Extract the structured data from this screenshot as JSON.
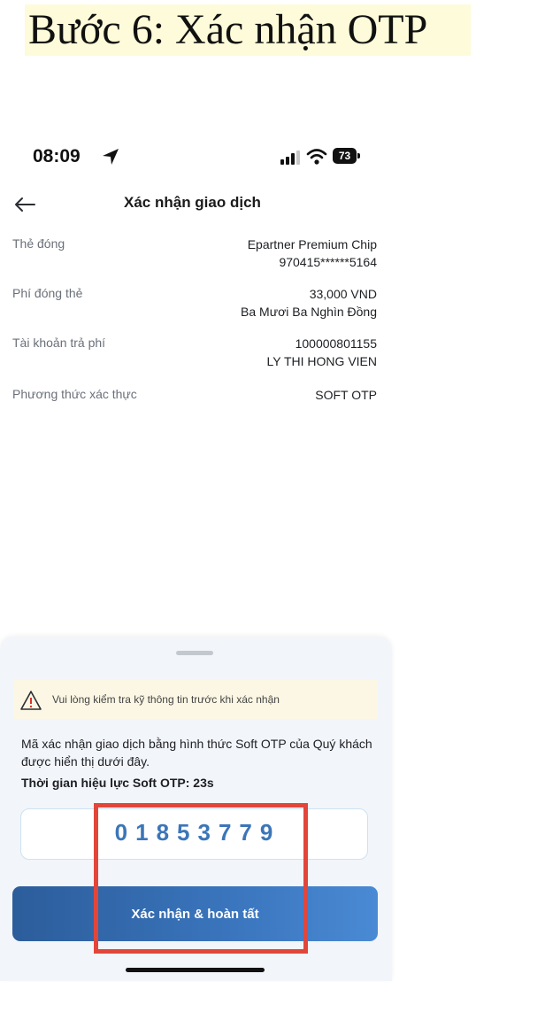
{
  "step_title": "Bước 6: Xác nhận OTP",
  "status_bar": {
    "time": "08:09",
    "battery": "73"
  },
  "header": {
    "title": "Xác nhận giao dịch"
  },
  "details": [
    {
      "label": "Thẻ đóng",
      "value_lines": [
        "Epartner Premium Chip",
        "970415******5164"
      ]
    },
    {
      "label": "Phí đóng thẻ",
      "value_lines": [
        "33,000 VND",
        "Ba Mươi Ba Nghìn Đồng"
      ]
    },
    {
      "label": "Tài khoản trả phí",
      "value_lines": [
        "100000801155",
        "LY THI HONG VIEN"
      ]
    },
    {
      "label": "Phương thức xác thực",
      "value_lines": [
        "SOFT OTP"
      ]
    }
  ],
  "sheet": {
    "warning": "Vui lòng kiểm tra kỹ thông tin trước khi xác nhận",
    "description": "Mã xác nhận giao dịch bằng hình thức Soft OTP của Quý khách được hiển thị dưới đây.",
    "timer": "Thời gian hiệu lực Soft OTP:  23s",
    "otp_code": "01853779",
    "confirm_label": "Xác nhận & hoàn tất"
  },
  "colors": {
    "accent": "#3c76b8",
    "button_start": "#2c5d9b",
    "button_end": "#4a8ad4",
    "highlight": "#e2463a",
    "title_bg": "#fdfbd9",
    "warning_bg": "#fcf7e4"
  },
  "icons": [
    "location-arrow-icon",
    "signal-icon",
    "wifi-icon",
    "battery-icon",
    "back-arrow-icon",
    "warning-icon"
  ]
}
